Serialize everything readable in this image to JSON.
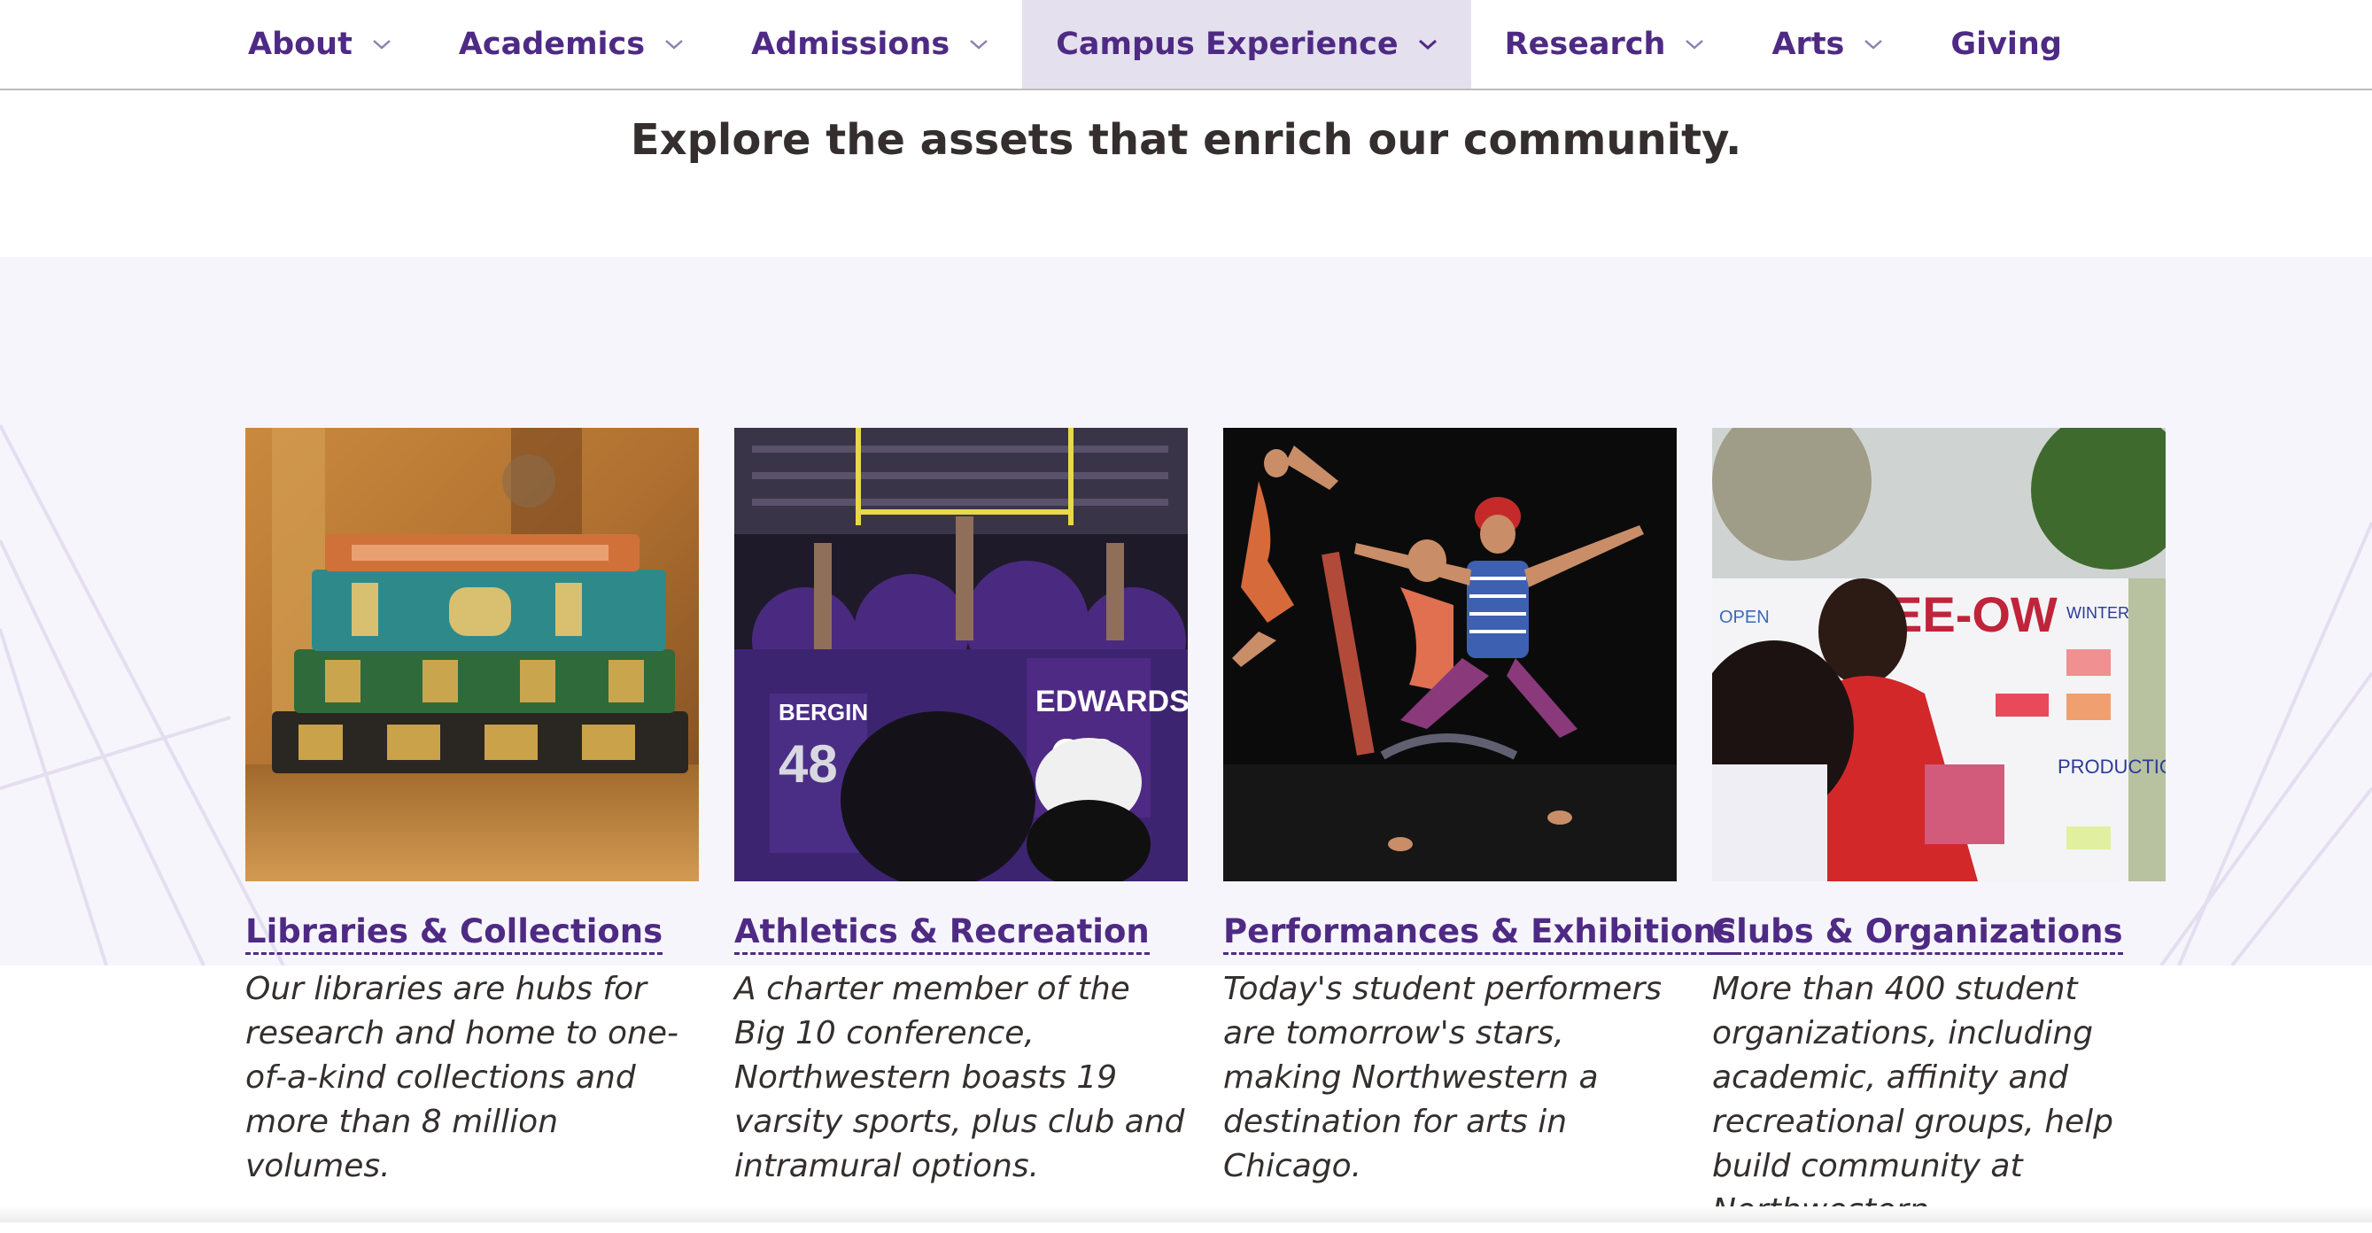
{
  "nav": {
    "items": [
      {
        "label": "About",
        "dropdown": true
      },
      {
        "label": "Academics",
        "dropdown": true
      },
      {
        "label": "Admissions",
        "dropdown": true
      },
      {
        "label": "Campus Experience",
        "dropdown": true,
        "active": true
      },
      {
        "label": "Research",
        "dropdown": true
      },
      {
        "label": "Arts",
        "dropdown": true
      },
      {
        "label": "Giving",
        "dropdown": false
      }
    ]
  },
  "intro": {
    "heading": "Explore the assets that enrich our community."
  },
  "cards": [
    {
      "title": "Libraries & Collections",
      "description": "Our libraries are hubs for research and home to one-of-a-kind collections and more than 8 million volumes.",
      "image_icon": "stacked-books-photo"
    },
    {
      "title": "Athletics & Recreation",
      "description": "A charter member of the Big 10 conference, Northwestern boasts 19 varsity sports, plus club and intramural options.",
      "image_icon": "football-team-celebration-photo"
    },
    {
      "title": "Performances & Exhibitions",
      "description": "Today's student performers are tomorrow's stars, making Northwestern a destination for arts in Chicago.",
      "image_icon": "dancers-on-stage-photo"
    },
    {
      "title": "Clubs & Organizations",
      "description": "More than 400 student organizations, including academic, affinity and recreational groups, help build community at Northwestern.",
      "image_icon": "student-club-fair-photo"
    }
  ],
  "colors": {
    "brand_purple": "#4e2a84",
    "active_tab_bg": "#e4e0ee",
    "band_bg": "#f7f5fc",
    "text_dark": "#342f2e"
  }
}
